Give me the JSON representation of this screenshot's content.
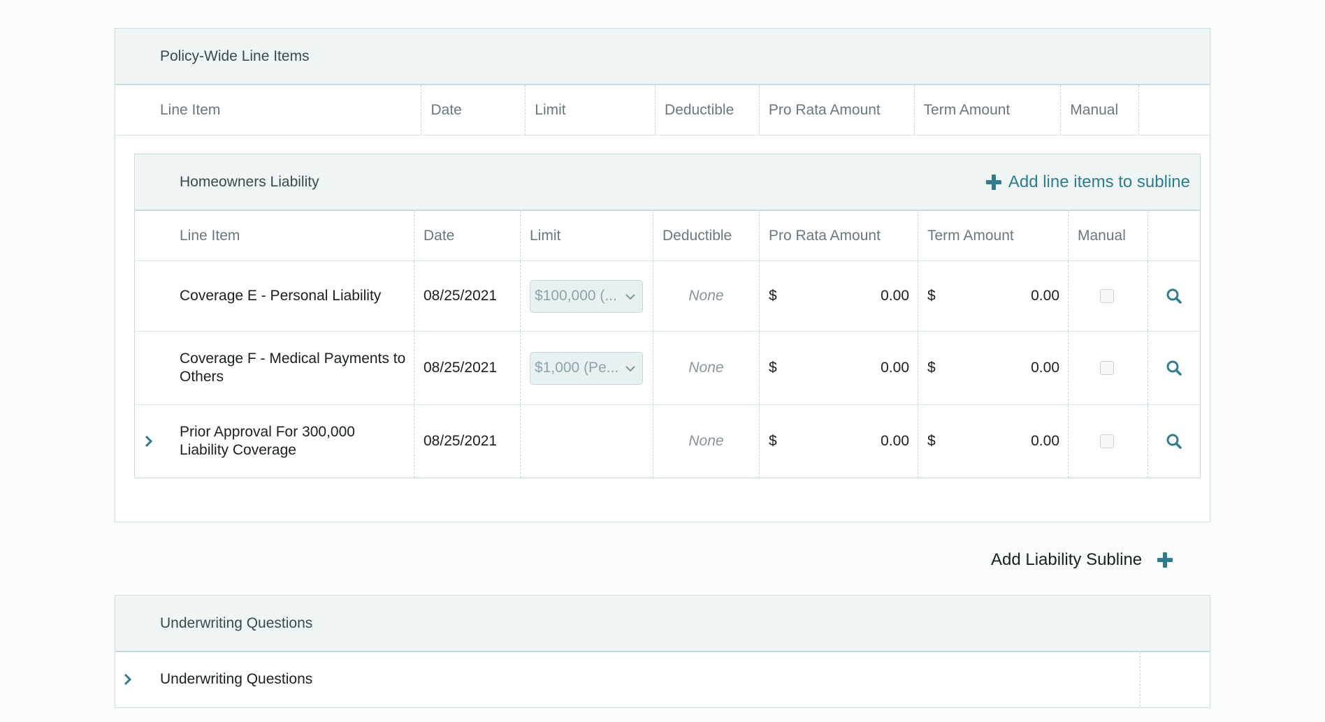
{
  "policy_wide": {
    "title": "Policy-Wide Line Items",
    "columns": [
      "Line Item",
      "Date",
      "Limit",
      "Deductible",
      "Pro Rata Amount",
      "Term Amount",
      "Manual",
      ""
    ]
  },
  "subline": {
    "title": "Homeowners Liability",
    "add_button_label": "Add line items to subline",
    "columns": [
      "Line Item",
      "Date",
      "Limit",
      "Deductible",
      "Pro Rata Amount",
      "Term Amount",
      "Manual",
      ""
    ],
    "rows": [
      {
        "line_item": "Coverage E - Personal Liability",
        "date": "08/25/2021",
        "limit": "$100,000 (...",
        "deductible": "None",
        "pro_rata_currency": "$",
        "pro_rata_amount": "0.00",
        "term_currency": "$",
        "term_amount": "0.00",
        "manual_checked": false,
        "expandable": false
      },
      {
        "line_item": "Coverage F - Medical Payments to Others",
        "date": "08/25/2021",
        "limit": "$1,000 (Pe...",
        "deductible": "None",
        "pro_rata_currency": "$",
        "pro_rata_amount": "0.00",
        "term_currency": "$",
        "term_amount": "0.00",
        "manual_checked": false,
        "expandable": false
      },
      {
        "line_item": "Prior Approval For 300,000 Liability Coverage",
        "date": "08/25/2021",
        "limit": "",
        "deductible": "None",
        "pro_rata_currency": "$",
        "pro_rata_amount": "0.00",
        "term_currency": "$",
        "term_amount": "0.00",
        "manual_checked": false,
        "expandable": true
      }
    ]
  },
  "add_liability_label": "Add Liability Subline",
  "underwriting": {
    "title": "Underwriting Questions",
    "row_label": "Underwriting Questions"
  },
  "colors": {
    "accent": "#2f7d8c",
    "header_bg": "#eff4f5",
    "border": "#c8dade"
  }
}
